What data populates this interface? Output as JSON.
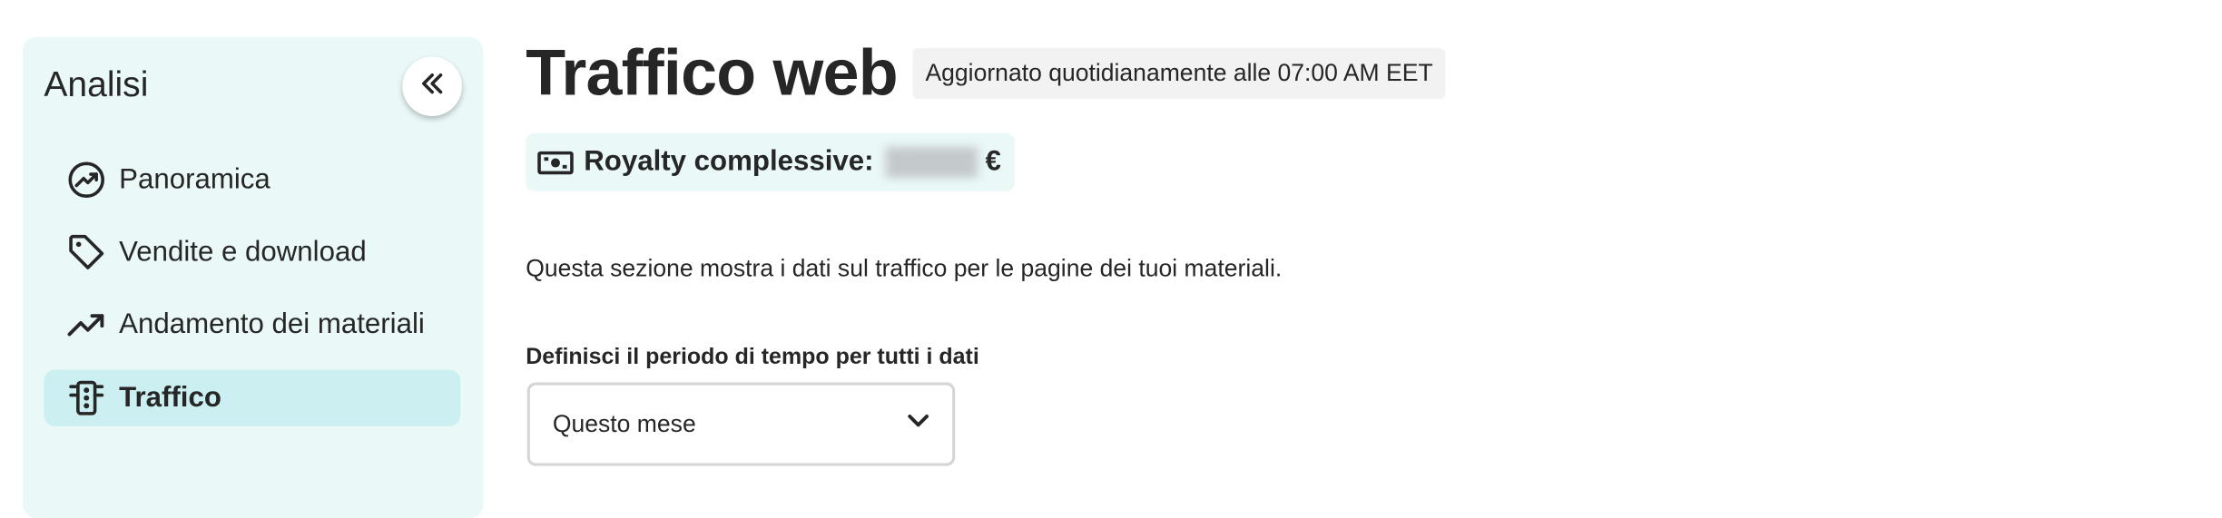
{
  "sidebar": {
    "title": "Analisi",
    "collapse_icon": "double-chevron-left-icon",
    "items": [
      {
        "label": "Panoramica",
        "icon": "chart-circle-icon",
        "active": false
      },
      {
        "label": "Vendite e download",
        "icon": "tag-icon",
        "active": false
      },
      {
        "label": "Andamento dei materiali",
        "icon": "trending-up-icon",
        "active": false
      },
      {
        "label": "Traffico",
        "icon": "traffic-light-icon",
        "active": true
      }
    ]
  },
  "header": {
    "title": "Traffico web",
    "update_badge": "Aggiornato quotidianamente alle 07:00 AM EET"
  },
  "royalty": {
    "icon": "banknote-icon",
    "label": "Royalty complessive:",
    "currency": "€"
  },
  "main": {
    "description": "Questa sezione mostra i dati sul traffico per le pagine dei tuoi materiali.",
    "period_label": "Definisci il periodo di tempo per tutti i dati",
    "period_selected": "Questo mese",
    "period_icon": "chevron-down-icon"
  },
  "colors": {
    "sidebar_bg": "#eaf8f8",
    "active_item_bg": "#ccf0f1",
    "text": "#262626"
  }
}
